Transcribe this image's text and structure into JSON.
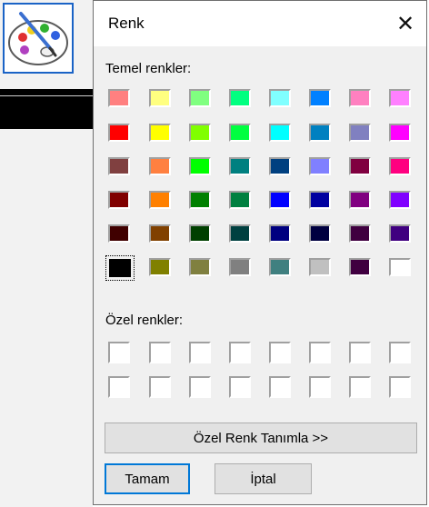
{
  "dialog": {
    "title": "Renk",
    "close_glyph": "✕",
    "basic_colors_label": "Temel renkler:",
    "custom_colors_label": "Özel renkler:",
    "define_custom_button": "Özel Renk Tanımla >>",
    "ok_button": "Tamam",
    "cancel_button": "İptal",
    "selected_basic_color": "#000000",
    "basic_colors": [
      [
        "#ff8080",
        "#ffff80",
        "#80ff80",
        "#00ff80",
        "#80ffff",
        "#0080ff",
        "#ff80c0",
        "#ff80ff"
      ],
      [
        "#ff0000",
        "#ffff00",
        "#80ff00",
        "#00ff40",
        "#00ffff",
        "#0080c0",
        "#8080c0",
        "#ff00ff"
      ],
      [
        "#804040",
        "#ff8040",
        "#00ff00",
        "#008080",
        "#004080",
        "#8080ff",
        "#800040",
        "#ff0080"
      ],
      [
        "#800000",
        "#ff8000",
        "#008000",
        "#008040",
        "#0000ff",
        "#0000a0",
        "#800080",
        "#8000ff"
      ],
      [
        "#400000",
        "#804000",
        "#004000",
        "#004040",
        "#000080",
        "#000040",
        "#400040",
        "#400080"
      ],
      [
        "#000000",
        "#808000",
        "#808040",
        "#808080",
        "#408080",
        "#c0c0c0",
        "#400040",
        "#ffffff"
      ]
    ],
    "custom_colors": [
      [
        "#ffffff",
        "#ffffff",
        "#ffffff",
        "#ffffff",
        "#ffffff",
        "#ffffff",
        "#ffffff",
        "#ffffff"
      ],
      [
        "#ffffff",
        "#ffffff",
        "#ffffff",
        "#ffffff",
        "#ffffff",
        "#ffffff",
        "#ffffff",
        "#ffffff"
      ]
    ]
  },
  "app": {
    "icon": "paint-palette-icon"
  }
}
